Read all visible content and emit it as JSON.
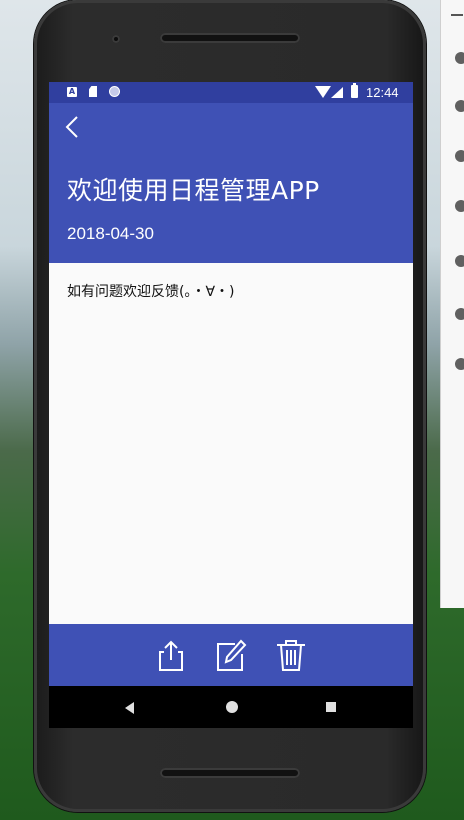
{
  "status_bar": {
    "time": "12:44",
    "notification_icons": [
      "a-badge-icon",
      "sd-card-icon",
      "sync-circle-icon"
    ],
    "system_icons": [
      "wifi-icon",
      "cell-signal-icon",
      "battery-charging-icon"
    ]
  },
  "app_bar": {
    "back_icon": "chevron-left-icon",
    "title": "欢迎使用日程管理APP",
    "date": "2018-04-30",
    "background_color": "#3f51b5",
    "status_color": "#303f9f"
  },
  "content": {
    "text": "如有问题欢迎反馈(｡・∀・)"
  },
  "bottom_bar": {
    "actions": [
      {
        "icon": "share-icon"
      },
      {
        "icon": "edit-icon"
      },
      {
        "icon": "trash-icon"
      }
    ]
  },
  "nav_bar": {
    "buttons": [
      "back-triangle-icon",
      "home-circle-icon",
      "recents-square-icon"
    ]
  }
}
